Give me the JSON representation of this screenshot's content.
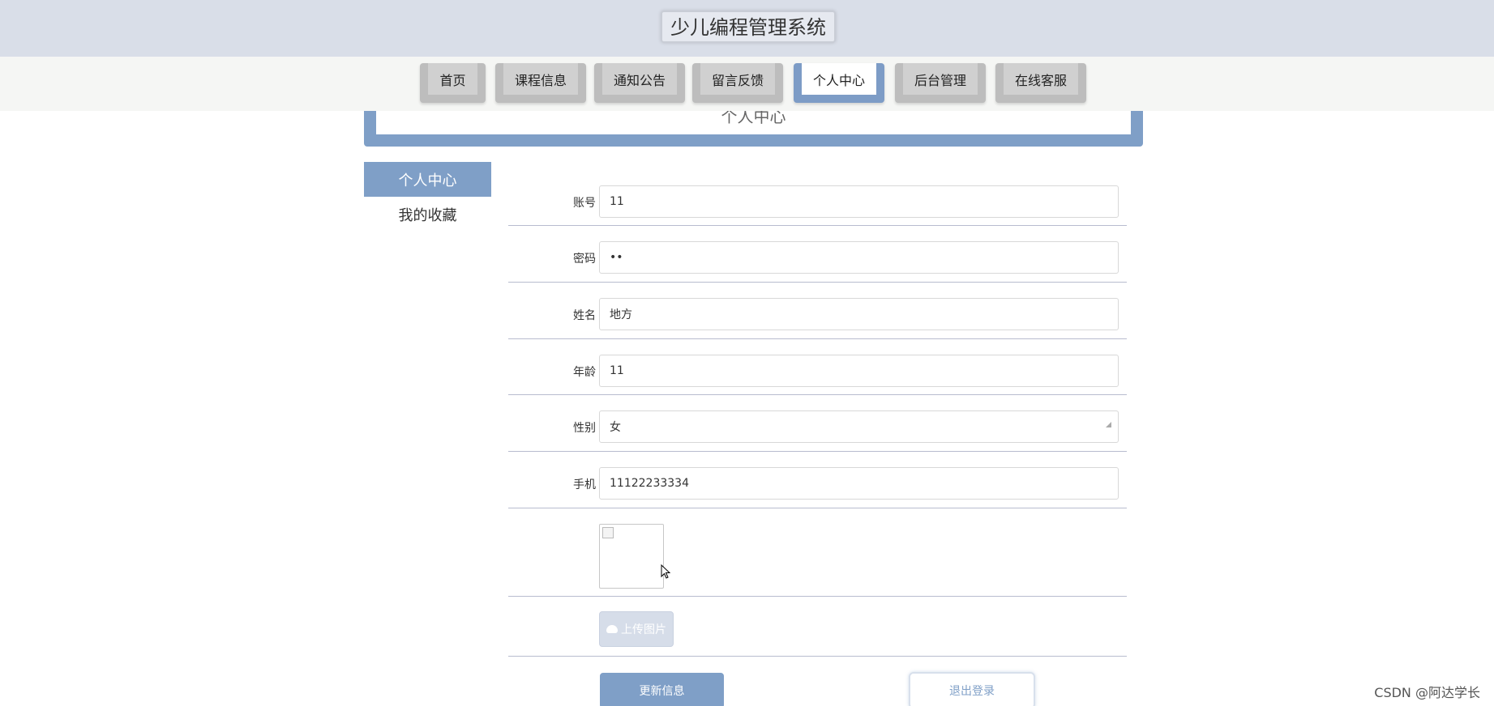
{
  "header": {
    "title": "少儿编程管理系统"
  },
  "nav": {
    "items": [
      {
        "label": "首页"
      },
      {
        "label": "课程信息"
      },
      {
        "label": "通知公告"
      },
      {
        "label": "留言反馈"
      },
      {
        "label": "个人中心"
      },
      {
        "label": "后台管理"
      },
      {
        "label": "在线客服"
      }
    ],
    "active": "个人中心"
  },
  "banner": {
    "title": "个人中心"
  },
  "sidebar": {
    "items": [
      {
        "label": "个人中心"
      },
      {
        "label": "我的收藏"
      }
    ]
  },
  "form": {
    "account": {
      "label": "账号",
      "value": "11"
    },
    "password": {
      "label": "密码",
      "value": "11"
    },
    "name": {
      "label": "姓名",
      "value": "地方"
    },
    "age": {
      "label": "年龄",
      "value": "11"
    },
    "gender": {
      "label": "性别",
      "value": "女"
    },
    "phone": {
      "label": "手机",
      "value": "11122233334"
    },
    "upload_label": "上传图片",
    "update_label": "更新信息",
    "logout_label": "退出登录"
  },
  "watermark": "CSDN @阿达学长",
  "colors": {
    "accent": "#7f9fc7",
    "header_bg": "#d9dee8",
    "nav_tab": "#bdbdbd"
  }
}
